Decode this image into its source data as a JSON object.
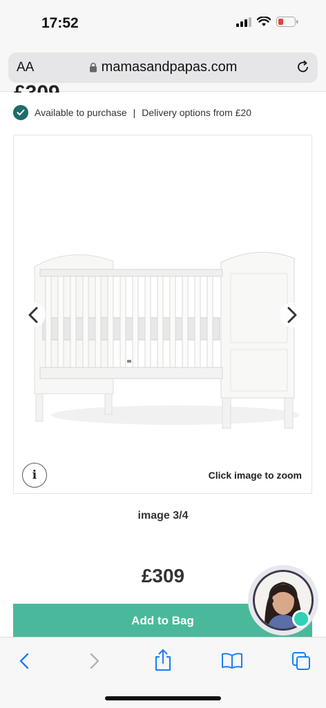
{
  "status_bar": {
    "time": "17:52"
  },
  "browser": {
    "text_size_label": "AA",
    "url": "mamasandpapas.com"
  },
  "product": {
    "price_cut": "£309",
    "availability": "Available to purchase",
    "separator": "|",
    "delivery": "Delivery options from £20",
    "zoom_hint": "Click image to zoom",
    "image_counter": "image 3/4",
    "price": "£309",
    "add_to_bag_label": "Add to Bag"
  },
  "colors": {
    "accent_teal": "#4ab99b",
    "check_green": "#1f6b6b",
    "online_dot": "#2fd1b7"
  },
  "icons": [
    "signal-icon",
    "wifi-icon",
    "battery-icon",
    "lock-icon",
    "reload-icon",
    "check-icon",
    "chevron-left-icon",
    "chevron-right-icon",
    "info-icon",
    "back-icon",
    "forward-icon",
    "share-icon",
    "bookmarks-icon",
    "tabs-icon"
  ]
}
